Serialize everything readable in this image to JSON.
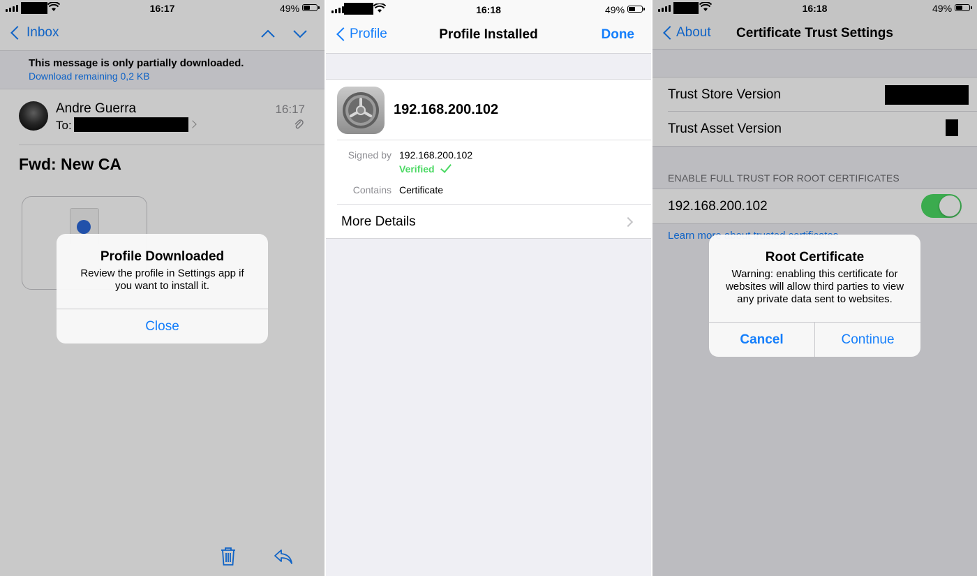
{
  "panel1": {
    "status": {
      "time": "16:17",
      "battery": "49%"
    },
    "nav": {
      "back_label": "Inbox"
    },
    "banner": {
      "line1": "This message is only partially downloaded.",
      "line2": "Download remaining 0,2 KB"
    },
    "mail": {
      "sender": "Andre Guerra",
      "to_label": "To:",
      "time": "16:17",
      "subject": "Fwd:  New CA"
    },
    "alert": {
      "title": "Profile Downloaded",
      "message": "Review the profile in Settings app if you want to install it.",
      "button": "Close"
    }
  },
  "panel2": {
    "status": {
      "time": "16:18",
      "battery": "49%"
    },
    "nav": {
      "back_label": "Profile",
      "title": "Profile Installed",
      "done_label": "Done"
    },
    "profile": {
      "name": "192.168.200.102",
      "signed_by_label": "Signed by",
      "signed_by_value": "192.168.200.102",
      "verified_label": "Verified",
      "contains_label": "Contains",
      "contains_value": "Certificate",
      "more_details": "More Details"
    }
  },
  "panel3": {
    "status": {
      "time": "16:18",
      "battery": "49%"
    },
    "nav": {
      "back_label": "About",
      "title": "Certificate Trust Settings"
    },
    "rows": {
      "trust_store": "Trust Store Version",
      "trust_asset": "Trust Asset Version"
    },
    "section_header": "ENABLE FULL TRUST FOR ROOT CERTIFICATES",
    "cert_name": "192.168.200.102",
    "cert_trusted": true,
    "learn_more": "Learn more about trusted certificates",
    "alert": {
      "title": "Root Certificate",
      "message": "Warning: enabling this certificate for websites will allow third parties to view any private data sent to websites.",
      "cancel": "Cancel",
      "continue": "Continue"
    }
  },
  "colors": {
    "ios_blue": "#147efb",
    "ios_green": "#4cd964",
    "group_bg": "#efeff4"
  }
}
